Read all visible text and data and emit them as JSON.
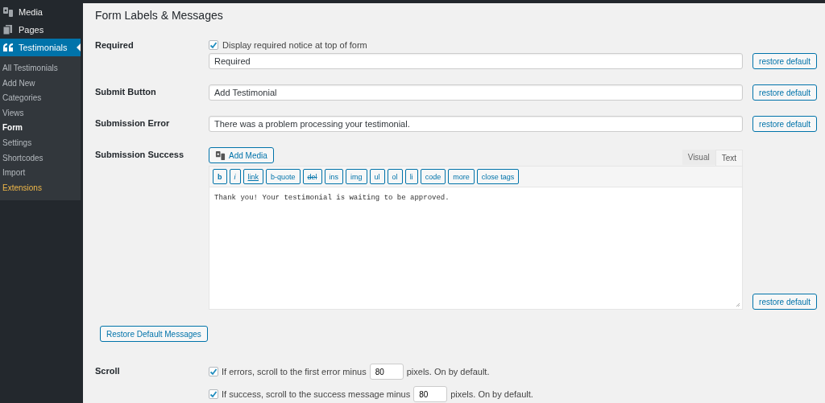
{
  "sidebar": {
    "items": [
      {
        "kind": "media",
        "label": "Media",
        "selected": false
      },
      {
        "kind": "pages",
        "label": "Pages",
        "selected": false
      },
      {
        "kind": "quote",
        "label": "Testimonials",
        "selected": true
      }
    ],
    "submenu": [
      {
        "label": "All Testimonials",
        "selected": false,
        "highlight": false
      },
      {
        "label": "Add New",
        "selected": false,
        "highlight": false
      },
      {
        "label": "Categories",
        "selected": false,
        "highlight": false
      },
      {
        "label": "Views",
        "selected": false,
        "highlight": false
      },
      {
        "label": "Form",
        "selected": true,
        "highlight": false
      },
      {
        "label": "Settings",
        "selected": false,
        "highlight": false
      },
      {
        "label": "Shortcodes",
        "selected": false,
        "highlight": false
      },
      {
        "label": "Import",
        "selected": false,
        "highlight": false
      },
      {
        "label": "Extensions",
        "selected": false,
        "highlight": true
      }
    ]
  },
  "section_title": "Form Labels & Messages",
  "required": {
    "label": "Required",
    "checkbox": {
      "label": "Display required notice at top of form",
      "checked": true
    },
    "value": "Required",
    "restore": "restore default"
  },
  "submit_button": {
    "label": "Submit Button",
    "value": "Add Testimonial",
    "restore": "restore default"
  },
  "submission_error": {
    "label": "Submission Error",
    "value": "There was a problem processing your testimonial.",
    "restore": "restore default"
  },
  "submission_success": {
    "label": "Submission Success",
    "add_media": "Add Media",
    "tabs": [
      {
        "label": "Visual",
        "selected": false
      },
      {
        "label": "Text",
        "selected": true
      }
    ],
    "toolbar": [
      {
        "label": "b",
        "kind": "bold"
      },
      {
        "label": "i",
        "kind": "italic"
      },
      {
        "label": "link",
        "kind": "link"
      },
      {
        "label": "b-quote",
        "kind": "plain"
      },
      {
        "label": "del",
        "kind": "strike"
      },
      {
        "label": "ins",
        "kind": "plain"
      },
      {
        "label": "img",
        "kind": "plain"
      },
      {
        "label": "ul",
        "kind": "plain"
      },
      {
        "label": "ol",
        "kind": "plain"
      },
      {
        "label": "li",
        "kind": "plain"
      },
      {
        "label": "code",
        "kind": "plain"
      },
      {
        "label": "more",
        "kind": "plain"
      },
      {
        "label": "close tags",
        "kind": "plain"
      }
    ],
    "value": "Thank you! Your testimonial is waiting to be approved.",
    "restore": "restore default"
  },
  "restore_all": "Restore Default Messages",
  "scroll": {
    "label": "Scroll",
    "options": [
      {
        "checked": true,
        "before": "If errors, scroll to the first error minus",
        "value": "80",
        "after": "pixels. On by default."
      },
      {
        "checked": true,
        "before": "If success, scroll to the success message minus",
        "value": "80",
        "after": "pixels. On by default."
      }
    ]
  }
}
